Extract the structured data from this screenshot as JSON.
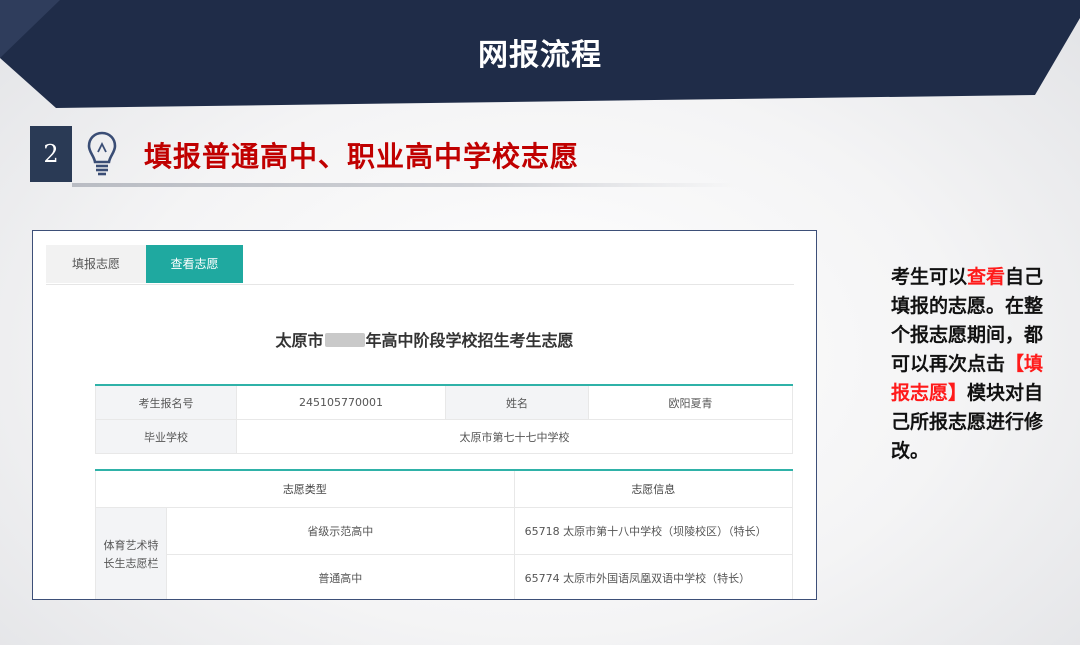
{
  "header": {
    "title": "网报流程"
  },
  "step": {
    "number": "2",
    "title": "填报普通高中、职业高中学校志愿"
  },
  "screenshot": {
    "tabs": [
      {
        "label": "填报志愿",
        "active": false
      },
      {
        "label": "查看志愿",
        "active": true
      }
    ],
    "form_title_prefix": "太原市",
    "form_title_suffix": "年高中阶段学校招生考生志愿",
    "info": {
      "reg_no_label": "考生报名号",
      "reg_no_value": "245105770001",
      "name_label": "姓名",
      "name_value": "欧阳夏青",
      "school_label": "毕业学校",
      "school_value": "太原市第七十七中学校"
    },
    "wish_table": {
      "col_type": "志愿类型",
      "col_info": "志愿信息",
      "group_label": "体育艺术特长生志愿栏",
      "rows": [
        {
          "type": "省级示范高中",
          "info": "65718 太原市第十八中学校（坝陵校区）（特长）"
        },
        {
          "type": "普通高中",
          "info": "65774 太原市外国语凤凰双语中学校（特长）"
        }
      ]
    }
  },
  "side_text": {
    "part1": "考生可以",
    "highlight1": "查看",
    "part2": "自己填报的志愿。在整个报志愿期间，都可以再次点击",
    "highlight2": "【填报志愿】",
    "part3": "模块对自己所报志愿进行修改。"
  },
  "colors": {
    "banner": "#1f2c48",
    "accent": "#c00000",
    "teal": "#1fa9a0"
  }
}
